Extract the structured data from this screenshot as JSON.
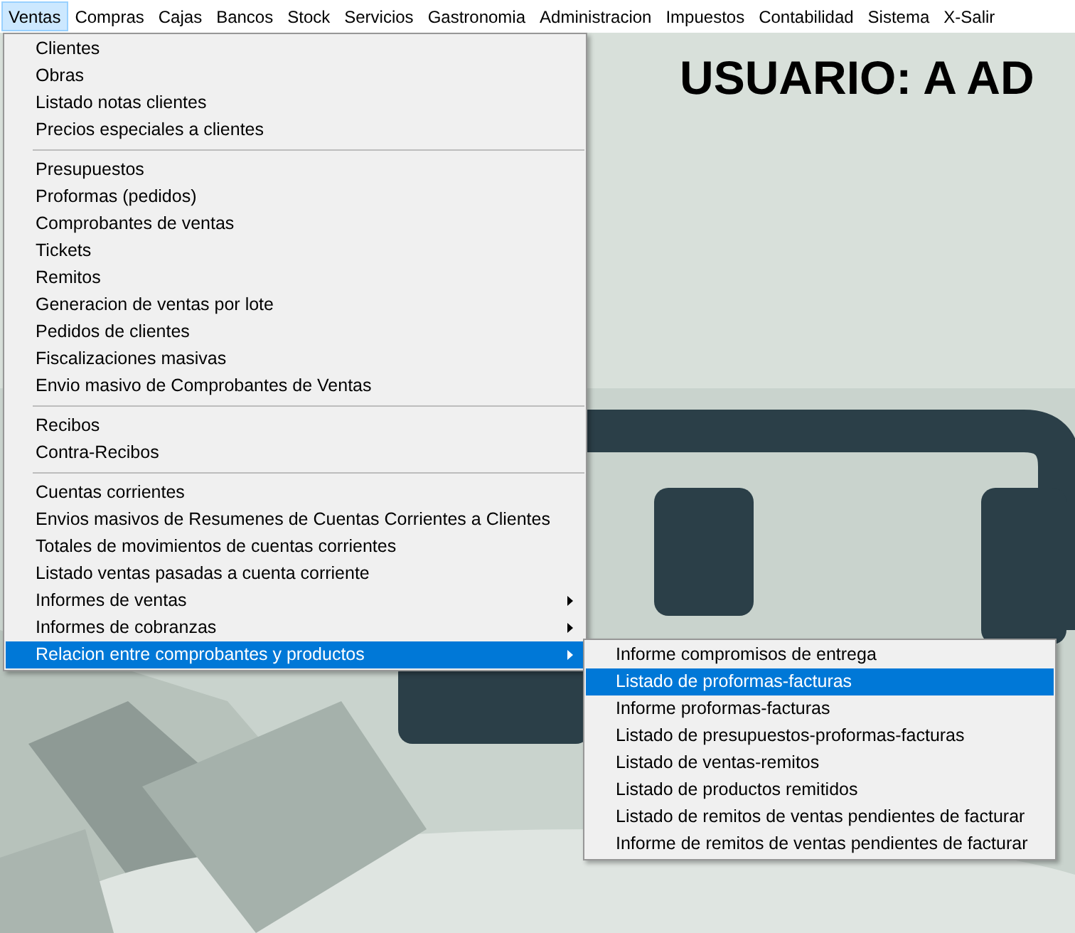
{
  "menu_bar": [
    {
      "label": "Ventas",
      "selected": true
    },
    {
      "label": "Compras",
      "selected": false
    },
    {
      "label": "Cajas",
      "selected": false
    },
    {
      "label": "Bancos",
      "selected": false
    },
    {
      "label": "Stock",
      "selected": false
    },
    {
      "label": "Servicios",
      "selected": false
    },
    {
      "label": "Gastronomia",
      "selected": false
    },
    {
      "label": "Administracion",
      "selected": false
    },
    {
      "label": "Impuestos",
      "selected": false
    },
    {
      "label": "Contabilidad",
      "selected": false
    },
    {
      "label": "Sistema",
      "selected": false
    },
    {
      "label": "X-Salir",
      "selected": false
    }
  ],
  "user_banner": "USUARIO: A AD",
  "dropdown": {
    "sections": [
      {
        "items": [
          {
            "label": "Clientes",
            "has_submenu": false,
            "selected": false
          },
          {
            "label": "Obras",
            "has_submenu": false,
            "selected": false
          },
          {
            "label": "Listado notas clientes",
            "has_submenu": false,
            "selected": false
          },
          {
            "label": "Precios especiales a clientes",
            "has_submenu": false,
            "selected": false
          }
        ]
      },
      {
        "items": [
          {
            "label": "Presupuestos",
            "has_submenu": false,
            "selected": false
          },
          {
            "label": "Proformas (pedidos)",
            "has_submenu": false,
            "selected": false
          },
          {
            "label": "Comprobantes de ventas",
            "has_submenu": false,
            "selected": false
          },
          {
            "label": "Tickets",
            "has_submenu": false,
            "selected": false
          },
          {
            "label": "Remitos",
            "has_submenu": false,
            "selected": false
          },
          {
            "label": "Generacion de ventas por lote",
            "has_submenu": false,
            "selected": false
          },
          {
            "label": "Pedidos de clientes",
            "has_submenu": false,
            "selected": false
          },
          {
            "label": "Fiscalizaciones masivas",
            "has_submenu": false,
            "selected": false
          },
          {
            "label": "Envio masivo de Comprobantes de Ventas",
            "has_submenu": false,
            "selected": false
          }
        ]
      },
      {
        "items": [
          {
            "label": "Recibos",
            "has_submenu": false,
            "selected": false
          },
          {
            "label": "Contra-Recibos",
            "has_submenu": false,
            "selected": false
          }
        ]
      },
      {
        "items": [
          {
            "label": "Cuentas corrientes",
            "has_submenu": false,
            "selected": false
          },
          {
            "label": "Envios masivos de Resumenes de Cuentas Corrientes a Clientes",
            "has_submenu": false,
            "selected": false
          },
          {
            "label": "Totales de movimientos de cuentas corrientes",
            "has_submenu": false,
            "selected": false
          },
          {
            "label": "Listado ventas pasadas a cuenta corriente",
            "has_submenu": false,
            "selected": false
          },
          {
            "label": "Informes de ventas",
            "has_submenu": true,
            "selected": false
          },
          {
            "label": "Informes de cobranzas",
            "has_submenu": true,
            "selected": false
          },
          {
            "label": "Relacion entre comprobantes y productos",
            "has_submenu": true,
            "selected": true
          }
        ]
      }
    ]
  },
  "submenu": {
    "items": [
      {
        "label": "Informe compromisos de entrega",
        "selected": false
      },
      {
        "label": "Listado de proformas-facturas",
        "selected": true
      },
      {
        "label": "Informe proformas-facturas",
        "selected": false
      },
      {
        "label": "Listado de presupuestos-proformas-facturas",
        "selected": false
      },
      {
        "label": "Listado de ventas-remitos",
        "selected": false
      },
      {
        "label": "Listado de productos remitidos",
        "selected": false
      },
      {
        "label": "Listado de remitos de ventas pendientes de facturar",
        "selected": false
      },
      {
        "label": "Informe de remitos de ventas pendientes de facturar",
        "selected": false
      }
    ]
  }
}
